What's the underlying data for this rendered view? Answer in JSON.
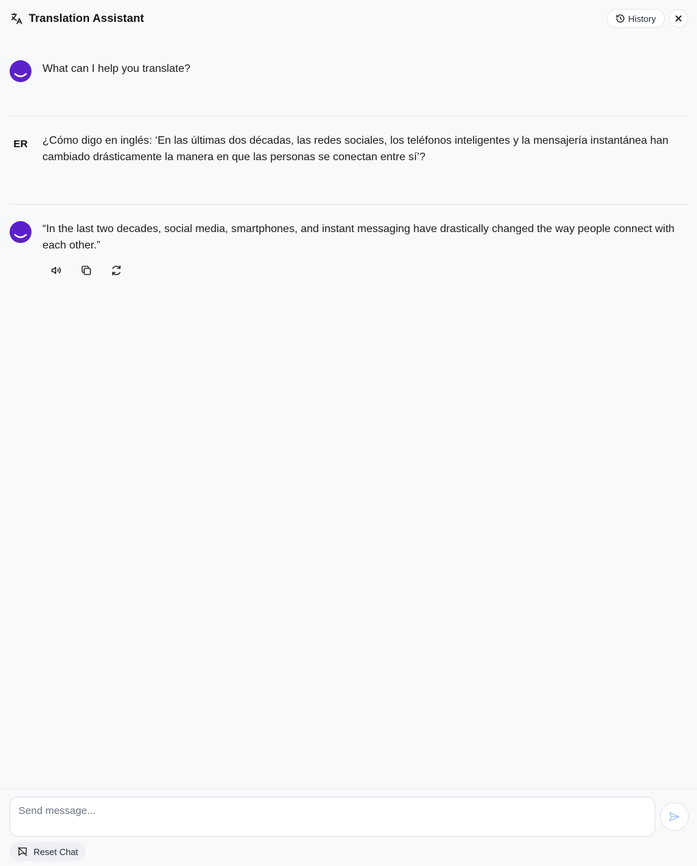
{
  "header": {
    "title": "Translation Assistant",
    "history_label": "History",
    "icons": {
      "translate": "translate-icon",
      "history": "history-icon",
      "close": "close-icon"
    }
  },
  "messages": [
    {
      "role": "assistant",
      "avatar": "smile-avatar",
      "text": "What can I help you translate?"
    },
    {
      "role": "user",
      "avatar_initials": "ER",
      "text": "¿Cómo digo en inglés: ‘En las últimas dos décadas, las redes sociales, los teléfonos inteligentes y la mensajería instantánea han cambiado drásticamente la manera en que las personas se conectan entre sí’?"
    },
    {
      "role": "assistant",
      "avatar": "smile-avatar",
      "text": "“In the last two decades, social media, smartphones, and instant messaging have drastically changed the way people connect with each other.”"
    }
  ],
  "message_tools": [
    {
      "name": "speaker-icon",
      "label": "Read aloud"
    },
    {
      "name": "copy-icon",
      "label": "Copy"
    },
    {
      "name": "refresh-icon",
      "label": "Regenerate"
    }
  ],
  "composer": {
    "placeholder": "Send message...",
    "value": "",
    "send_icon": "send-icon",
    "reset_label": "Reset Chat",
    "reset_icon": "chat-off-icon"
  },
  "colors": {
    "accent": "#5b21c8",
    "background": "#f8f9fb",
    "send_icon": "#9ec3ee"
  }
}
